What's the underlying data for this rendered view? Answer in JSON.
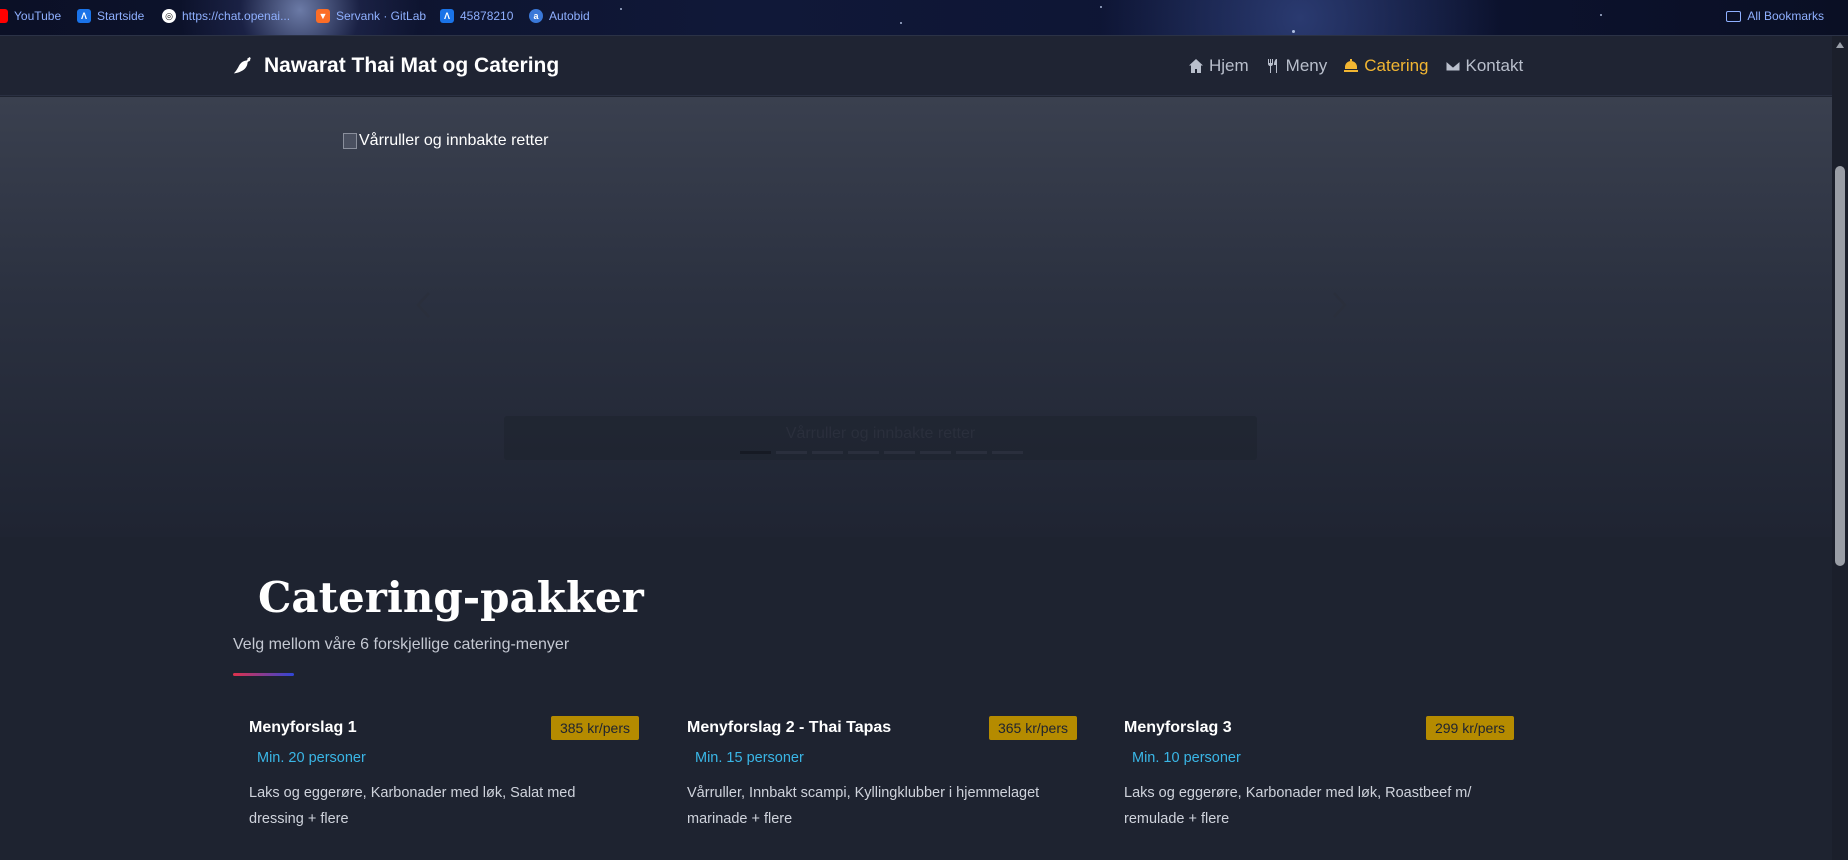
{
  "bookmarks": {
    "items": [
      {
        "label": "YouTube",
        "icon": "youtube-icon",
        "color": "#ff0000"
      },
      {
        "label": "Startside",
        "icon": "tool-icon",
        "color": "#1a73e8"
      },
      {
        "label": "https://chat.openai...",
        "icon": "openai-icon",
        "color": "#ffffff"
      },
      {
        "label": "Servank · GitLab",
        "icon": "gitlab-icon",
        "color": "#fc6d26"
      },
      {
        "label": "45878210",
        "icon": "tool-icon",
        "color": "#1a73e8"
      },
      {
        "label": "Autobid",
        "icon": "autobid-icon",
        "color": "#3a78d8"
      }
    ],
    "all_bookmarks": "All Bookmarks"
  },
  "navbar": {
    "brand": "Nawarat Thai Mat og Catering",
    "links": [
      {
        "label": "Hjem",
        "icon": "home-icon",
        "active": false
      },
      {
        "label": "Meny",
        "icon": "utensils-icon",
        "active": false
      },
      {
        "label": "Catering",
        "icon": "bell-icon",
        "active": true
      },
      {
        "label": "Kontakt",
        "icon": "envelope-icon",
        "active": false
      }
    ],
    "accent_color": "#f2b632"
  },
  "hero": {
    "image_alt": "Vårruller og innbakte retter",
    "caption": "Vårruller og innbakte retter",
    "indicator_count": 8,
    "active_index": 0
  },
  "section": {
    "title": "Catering-pakker",
    "subtitle": "Velg mellom våre 6 forskjellige catering-menyer"
  },
  "cards": [
    {
      "title": "Menyforslag 1",
      "price": "385 kr/pers",
      "min": "Min. 20 personer",
      "desc": "Laks og eggerøre, Karbonader med løk, Salat med dressing + flere"
    },
    {
      "title": "Menyforslag 2 - Thai Tapas",
      "price": "365 kr/pers",
      "min": "Min. 15 personer",
      "desc": "Vårruller, Innbakt scampi, Kyllingklubber i hjemmelaget marinade + flere"
    },
    {
      "title": "Menyforslag 3",
      "price": "299 kr/pers",
      "min": "Min. 10 personer",
      "desc": "Laks og eggerøre, Karbonader med løk, Roastbeef m/ remulade + flere"
    }
  ]
}
